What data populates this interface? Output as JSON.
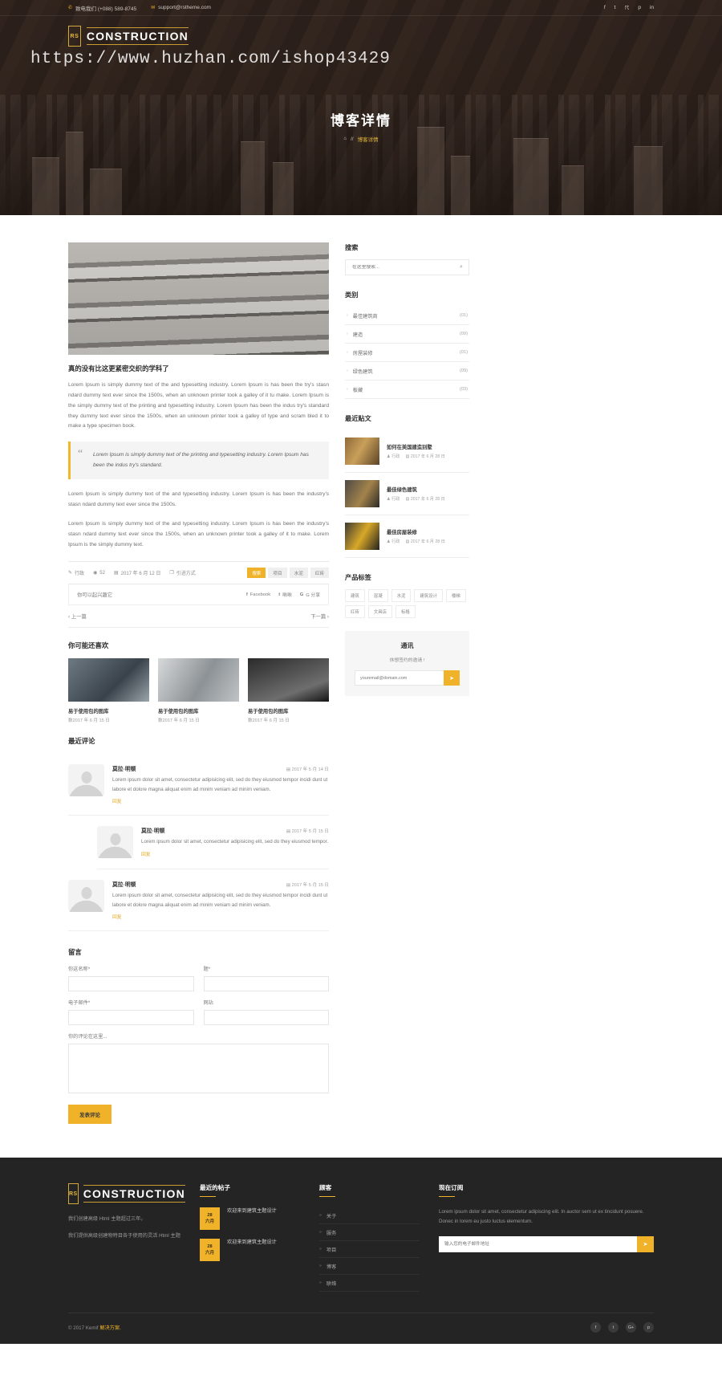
{
  "topbar": {
    "phone_icon": "phone-icon",
    "phone": "致电我们 (+088) 589-8745",
    "mail_icon": "mail-icon",
    "email": "support@rstheme.com",
    "social": [
      "f",
      "t",
      "☈",
      "p",
      "in"
    ]
  },
  "brand": {
    "mark": "RS",
    "name": "CONSTRUCTION"
  },
  "watermark": "https://www.huzhan.com/ishop43429",
  "hero": {
    "title": "博客详情",
    "home_icon": "home-icon",
    "separator": "//",
    "current": "博客详情"
  },
  "article": {
    "title": "真的没有比这更紧密交织的学科了",
    "para1": "Lorem Ipsum is simply dummy text of the and typesetting industry. Lorem Ipsum is has been the try's stasn ndard dummy text ever since the 1500s, when an unknown printer took a galley of it tu make. Lorem Ipsum is the simply dummy text of the printing and typesetting industry. Lorem Ipsum has been the indus try's standard they dummy text ever since the 1500s, when an unknown printer took a galley of type and scram bled it to make a type specimen book.",
    "quote_mark": "“",
    "quote": "Lorem Ipsum is simply dummy text of the printing and typesetting industry. Lorem Ipsum has been the indus try's standard.",
    "para2": "Lorem Ipsum is simply dummy text of the and typesetting industry. Lorem Ipsum is has been the industry's stasn ndard dummy text ever since the 1500s.",
    "para3": "Lorem Ipsum is simply dummy text of the and typesetting industry. Lorem Ipsum is has been the industry's stasn ndard dummy text ever since the 1500s, when an unknown printer took a galley of it to make. Lorem Ipsum is the simply dummy text.",
    "meta": {
      "comments_icon": "comment-icon",
      "comments": "行政",
      "views_icon": "eye-icon",
      "views": "52",
      "date_icon": "calendar-icon",
      "date": "2017 年 6 月 12 日",
      "cat_icon": "folder-icon",
      "cat": "引进方式"
    },
    "tags": [
      {
        "label": "搜索",
        "active": true
      },
      {
        "label": "项目",
        "active": false
      },
      {
        "label": "水泥",
        "active": false
      },
      {
        "label": "红砖",
        "active": false
      }
    ],
    "share_label": "你可以起兴趣它",
    "share": [
      {
        "icon": "facebook-icon",
        "label": "Facebook"
      },
      {
        "icon": "twitter-icon",
        "label": "啾啾"
      },
      {
        "icon": "google-plus-icon",
        "label": "G 分享"
      }
    ],
    "prev": "上一篇",
    "next": "下一篇"
  },
  "related": {
    "heading": "你可能还喜欢",
    "items": [
      {
        "title": "易于使用包的图库",
        "date": "数2017 年 6 月 15 日",
        "style": "a"
      },
      {
        "title": "易于使用包的图库",
        "date": "数2017 年 6 月 15 日",
        "style": "b"
      },
      {
        "title": "易于使用包的图库",
        "date": "数2017 年 6 月 15 日",
        "style": "c"
      }
    ]
  },
  "comments": {
    "heading": "最近评论",
    "items": [
      {
        "name": "莫拉·明顿",
        "date_icon": "calendar-icon",
        "date": "2017 年 5 月 14 日",
        "text": "Lorem ipsum dolor sit amet, consectetur adipisicing elit, sed do they eiusmod tempor incidi dunt ut labore et dolore magna aliquat enim ad minim veniam ad minim veniam.",
        "reply": "回复",
        "indent": false
      },
      {
        "name": "莫拉·明顿",
        "date_icon": "calendar-icon",
        "date": "2017 年 5 月 15 日",
        "text": "Lorem ipsum dolor sit amet, consectetur adipisicing elit, sed do they eiusmod tempor.",
        "reply": "回复",
        "indent": true
      },
      {
        "name": "莫拉·明顿",
        "date_icon": "calendar-icon",
        "date": "2017 年 5 月 15 日",
        "text": "Lorem ipsum dolor sit amet, consectetur adipisicing elit, sed do they eiusmod tempor incidi dunt ut labore et dolore magna aliquat enim ad minim veniam ad minim veniam.",
        "reply": "回复",
        "indent": false
      }
    ]
  },
  "form": {
    "heading": "留言",
    "name_label": "你这名称*",
    "subject_label": "题*",
    "email_label": "电子邮件*",
    "website_label": "网站",
    "message_label": "你的评论在这里...",
    "name_value": "",
    "subject_value": "",
    "email_value": "",
    "website_value": "",
    "message_value": "",
    "submit": "发表评论"
  },
  "sidebar": {
    "search": {
      "heading": "搜索",
      "placeholder": "在这里搜索...",
      "icon": "search-icon"
    },
    "categories": {
      "heading": "类别",
      "items": [
        {
          "label": "最佳建筑商",
          "count": "(01)"
        },
        {
          "label": "建造",
          "count": "(09)"
        },
        {
          "label": "房屋装修",
          "count": "(01)"
        },
        {
          "label": "绿色建筑",
          "count": "(09)"
        },
        {
          "label": "板藏",
          "count": "(03)"
        }
      ]
    },
    "recent": {
      "heading": "最近贴文",
      "items": [
        {
          "title": "如何在美国建造别墅",
          "author_icon": "user-icon",
          "author": "行政",
          "date_icon": "calendar-icon",
          "date": "2017 年 6 月 28 日",
          "thumb": "i1"
        },
        {
          "title": "最佳绿色建筑",
          "author_icon": "user-icon",
          "author": "行政",
          "date_icon": "calendar-icon",
          "date": "2017 年 6 月 28 日",
          "thumb": "i2"
        },
        {
          "title": "最佳房屋装修",
          "author_icon": "user-icon",
          "author": "行政",
          "date_icon": "calendar-icon",
          "date": "2017 年 6 月 28 日",
          "thumb": "i3"
        }
      ]
    },
    "tags": {
      "heading": "产品标签",
      "items": [
        "建筑",
        "混凝",
        "水泥",
        "建筑设计",
        "楼梯",
        "红砖",
        "文具店",
        "标格"
      ]
    },
    "newsletter": {
      "heading": "通讯",
      "subtitle": "休想签约的邀请 !",
      "placeholder": "youremail@domain.com",
      "button_icon": "send-icon"
    }
  },
  "footer": {
    "brand": {
      "mark": "RS",
      "name": "CONSTRUCTION"
    },
    "about1": "我们创建高级 Html 主题超过三年。",
    "about2": "我们提供高级创建物特目各于使用的灵活 Html 主题",
    "recent": {
      "heading": "最近的帖子",
      "items": [
        {
          "day": "28",
          "month": "六月",
          "title": "欢迎来到建筑主题设计"
        },
        {
          "day": "28",
          "month": "六月",
          "title": "欢迎来到建筑主题设计"
        }
      ]
    },
    "links": {
      "heading": "顾客",
      "items": [
        "关于",
        "服务",
        "项目",
        "博客",
        "联络"
      ]
    },
    "subscribe": {
      "heading": "现在订阅",
      "text": "Lorem ipsum dolor sit amet, consectetur adipiscing elit. In auctor sem ut ex tincidunt posuere. Donec in lorem eu justo luctus elementum.",
      "placeholder": "输入您的电子邮件地址",
      "button_icon": "send-icon"
    },
    "copyright_prefix": "© 2017 Kemif ",
    "copyright_brand": "解决方案.",
    "social": [
      "f",
      "t",
      "G+",
      "p"
    ]
  }
}
